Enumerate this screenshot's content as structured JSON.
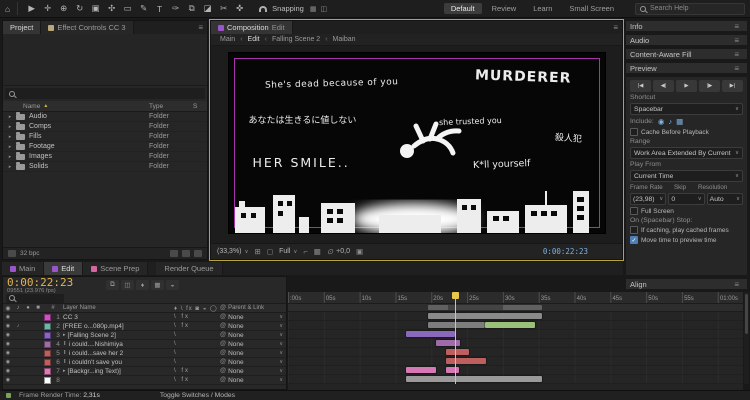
{
  "toolbar": {
    "tools": [
      {
        "name": "home-icon",
        "glyph": "⌂"
      },
      {
        "name": "selection-tool",
        "glyph": "▶"
      },
      {
        "name": "hand-tool",
        "glyph": "✛"
      },
      {
        "name": "zoom-tool",
        "glyph": "⊕"
      },
      {
        "name": "orbit-camera-tool",
        "glyph": "↻"
      },
      {
        "name": "camera-tool",
        "glyph": "▣"
      },
      {
        "name": "pan-behind-tool",
        "glyph": "✣"
      },
      {
        "name": "shape-tool",
        "glyph": "▭"
      },
      {
        "name": "pen-tool",
        "glyph": "✎"
      },
      {
        "name": "type-tool",
        "glyph": "T"
      },
      {
        "name": "brush-tool",
        "glyph": "✑"
      },
      {
        "name": "clone-stamp-tool",
        "glyph": "⧉"
      },
      {
        "name": "eraser-tool",
        "glyph": "◪"
      },
      {
        "name": "roto-brush-tool",
        "glyph": "✂"
      },
      {
        "name": "puppet-pin-tool",
        "glyph": "✜"
      }
    ],
    "snapping_label": "Snapping",
    "workspaces": [
      {
        "label": "Default",
        "active": true
      },
      {
        "label": "Review"
      },
      {
        "label": "Learn"
      },
      {
        "label": "Small Screen"
      }
    ],
    "search_placeholder": "Search Help"
  },
  "project": {
    "tabs": [
      {
        "label": "Project",
        "active": true
      },
      {
        "label": "Effect Controls CC 3"
      }
    ],
    "columns": {
      "name": "Name",
      "type": "Type",
      "size": "S"
    },
    "items": [
      {
        "name": "Audio",
        "type": "Folder"
      },
      {
        "name": "Comps",
        "type": "Folder"
      },
      {
        "name": "Fills",
        "type": "Folder"
      },
      {
        "name": "Footage",
        "type": "Folder"
      },
      {
        "name": "Images",
        "type": "Folder"
      },
      {
        "name": "Solids",
        "type": "Folder"
      }
    ],
    "footer_bpc": "32 bpc"
  },
  "comp": {
    "tab_label": "Composition",
    "tab_comp_name": "Edit",
    "breadcrumb": [
      {
        "label": "Main"
      },
      {
        "label": "Edit",
        "active": true
      },
      {
        "label": "Falling Scene 2"
      },
      {
        "label": "Maiban"
      }
    ],
    "texts": [
      {
        "name": "text-shes-dead",
        "value": "She's dead because of you"
      },
      {
        "name": "text-murderer",
        "value": "MURDERER"
      },
      {
        "name": "text-jp-worthless",
        "value": "あなたは生きるに値しない"
      },
      {
        "name": "text-she-trusted",
        "value": "she trusted you"
      },
      {
        "name": "text-jp-murderer",
        "value": "殺人犯"
      },
      {
        "name": "text-her-smile",
        "value": "HER SMILE.."
      },
      {
        "name": "text-kill-yourself",
        "value": "K*ll yourself"
      }
    ],
    "footer": {
      "zoom": "(33,3%)",
      "resolution": "Full",
      "exposure": "+0,0",
      "timecode": "0:00:22:23"
    }
  },
  "right": {
    "info_title": "Info",
    "audio_title": "Audio",
    "caf_title": "Content-Aware Fill",
    "preview_title": "Preview",
    "align_title": "Align",
    "preview": {
      "transport": [
        {
          "name": "first-frame",
          "glyph": "|◀"
        },
        {
          "name": "previous-frame",
          "glyph": "◀|"
        },
        {
          "name": "play",
          "glyph": "▶"
        },
        {
          "name": "next-frame",
          "glyph": "|▶"
        },
        {
          "name": "last-frame",
          "glyph": "▶|"
        }
      ],
      "shortcut_label": "Shortcut",
      "shortcut_value": "Spacebar",
      "include_label": "Include:",
      "cache_before_label": "Cache Before Playback",
      "range_label": "Range",
      "range_value": "Work Area Extended By Current",
      "play_from_label": "Play From",
      "play_from_value": "Current Time",
      "frame_rate_label": "Frame Rate",
      "skip_label": "Skip",
      "resolution_label": "Resolution",
      "frame_rate_value": "(23,98)",
      "skip_value": "0",
      "resolution_value": "Auto",
      "full_screen_label": "Full Screen",
      "stop_label": "On (Spacebar) Stop:",
      "cache_frames_label": "If caching, play cached frames",
      "move_time_label": "Move time to preview time",
      "move_time_checked": true
    }
  },
  "timeline": {
    "tabs": [
      {
        "label": "Main",
        "chip": "#9a55c8"
      },
      {
        "label": "Edit",
        "chip": "#9a55c8",
        "active": true
      },
      {
        "label": "Scene Prep",
        "chip": "#d4679f"
      },
      {
        "label": "Render Queue",
        "gap": true
      }
    ],
    "timecode": "0:00:22:23",
    "frame_info": "09551 (23.976 fps)",
    "number_col": "#",
    "layer_name_col": "Layer Name",
    "parent_link_col": "Parent & Link",
    "view_seconds": 63.5,
    "playhead_s": 23.3,
    "work_area": {
      "start": 19.5,
      "end": 35.5,
      "inner_start": 22.3,
      "inner_end": 30
    },
    "ruler": [
      {
        "t": 0,
        "label": ":00s"
      },
      {
        "t": 5,
        "label": "05s"
      },
      {
        "t": 10,
        "label": "10s"
      },
      {
        "t": 15,
        "label": "15s"
      },
      {
        "t": 20,
        "label": "20s"
      },
      {
        "t": 25,
        "label": "25s"
      },
      {
        "t": 30,
        "label": "30s"
      },
      {
        "t": 35,
        "label": "35s"
      },
      {
        "t": 40,
        "label": "40s"
      },
      {
        "t": 45,
        "label": "45s"
      },
      {
        "t": 50,
        "label": "50s"
      },
      {
        "t": 55,
        "label": "55s"
      },
      {
        "t": 60,
        "label": "01:00s"
      }
    ],
    "layers": [
      {
        "num": "1",
        "name": "CC 3",
        "chip": "#d44fc0",
        "kind": "solid",
        "video": true,
        "audio": false,
        "fx": true,
        "parent": "None",
        "segments": [
          {
            "start": 19.5,
            "end": 35.5,
            "color": "#8a8a8a"
          }
        ]
      },
      {
        "num": "2",
        "name": "[FREE o...080p.mp4]",
        "chip": "#6fb3a9",
        "kind": "footage",
        "video": true,
        "audio": true,
        "fx": true,
        "parent": "None",
        "segments": [
          {
            "start": 19.5,
            "end": 27.5,
            "color": "#7d7d7d"
          },
          {
            "start": 27.5,
            "end": 34.5,
            "color": "#9bc07a"
          }
        ]
      },
      {
        "num": "3",
        "name": "[Falling Scene 2]",
        "chip": "#8a63c6",
        "kind": "precomp",
        "video": true,
        "audio": false,
        "fx": false,
        "parent": "None",
        "segments": [
          {
            "start": 16.4,
            "end": 23.3,
            "color": "#8a68bc"
          }
        ]
      },
      {
        "num": "4",
        "name": "i could....Nishimiya",
        "chip": "#a06ba8",
        "kind": "text",
        "video": true,
        "audio": false,
        "fx": false,
        "parent": "None",
        "segments": [
          {
            "start": 20.6,
            "end": 24,
            "color": "#a06ba8"
          }
        ]
      },
      {
        "num": "5",
        "name": "i could...save her 2",
        "chip": "#bd5f5f",
        "kind": "text",
        "video": true,
        "audio": false,
        "fx": false,
        "parent": "None",
        "segments": [
          {
            "start": 22,
            "end": 25.2,
            "color": "#bd5f5f"
          }
        ]
      },
      {
        "num": "6",
        "name": "i couldn't save you",
        "chip": "#bd5f5f",
        "kind": "text",
        "video": true,
        "audio": false,
        "fx": false,
        "parent": "None",
        "segments": [
          {
            "start": 22,
            "end": 27.6,
            "color": "#bd5f5f"
          }
        ]
      },
      {
        "num": "7",
        "name": "[Backgr...ing Text)]",
        "chip": "#e07ab8",
        "kind": "precomp",
        "video": true,
        "audio": false,
        "fx": true,
        "parent": "None",
        "segments": [
          {
            "start": 16.4,
            "end": 20.6,
            "color": "#d678b6"
          },
          {
            "start": 22,
            "end": 23.8,
            "color": "#d678b6"
          }
        ]
      },
      {
        "num": "8",
        "name": "",
        "chip": "#ffffff",
        "kind": "solid",
        "video": true,
        "audio": false,
        "fx": true,
        "parent": "None",
        "segments": [
          {
            "start": 16.4,
            "end": 35.5,
            "color": "#9a9a9a"
          }
        ]
      }
    ],
    "status": {
      "render_time_label": "Frame Render Time:",
      "render_time_value": "2,31s",
      "toggle_label": "Toggle Switches / Modes"
    }
  },
  "icons": {
    "eye": "◉",
    "audio": "♪",
    "solo": "●",
    "lock": "■",
    "menu": "≡",
    "chevron": "∨",
    "sort": "▲",
    "pickwhip": "@",
    "switches_header": "♦ \\ fx ◙ ◒ ◯",
    "grid": "⊞",
    "mask": "◻",
    "roi": "⌐",
    "checker": "▦",
    "camera": "▣",
    "exposure": "⊙",
    "flowchart": "⧉",
    "draft3d": "◫",
    "shy": "♦",
    "blend": "▦",
    "mblur": "◒",
    "snap1": "▦",
    "snap2": "◫"
  }
}
